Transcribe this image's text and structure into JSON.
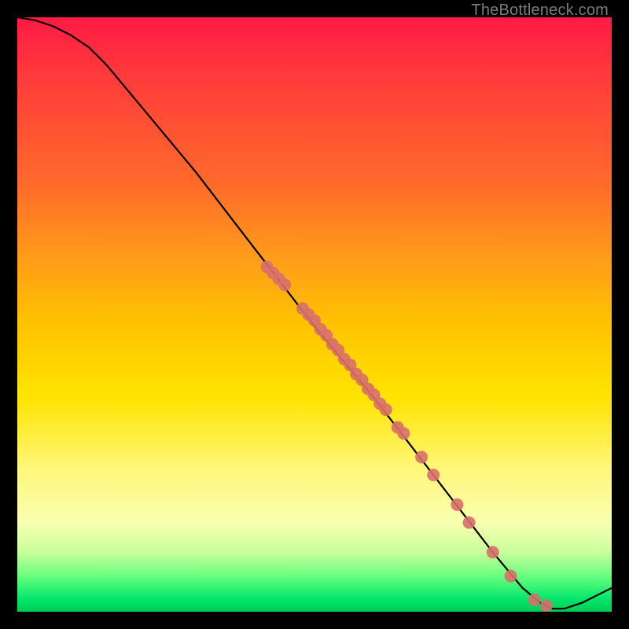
{
  "attribution": "TheBottleneck.com",
  "chart_data": {
    "type": "line",
    "title": "",
    "xlabel": "",
    "ylabel": "",
    "xlim": [
      0,
      100
    ],
    "ylim": [
      0,
      100
    ],
    "gradient_colors": {
      "top": "#ff1a44",
      "mid_high": "#ff9a1a",
      "mid": "#ffe400",
      "low": "#c9ff9a",
      "bottom": "#00cc55"
    },
    "series": [
      {
        "name": "bottleneck-curve",
        "color": "#000000",
        "x": [
          0,
          3,
          6,
          9,
          12,
          15,
          20,
          30,
          40,
          50,
          60,
          70,
          80,
          85,
          88,
          90,
          92,
          95,
          100
        ],
        "y": [
          100,
          99.5,
          98.5,
          97,
          95,
          92,
          86,
          74,
          61,
          48,
          36,
          23,
          10,
          4,
          1.5,
          0.5,
          0.5,
          1.5,
          4
        ]
      }
    ],
    "markers": {
      "name": "sample-points",
      "color": "#d86f6a",
      "radius": 8,
      "points": [
        {
          "x": 42,
          "y": 58
        },
        {
          "x": 43,
          "y": 57
        },
        {
          "x": 44,
          "y": 56
        },
        {
          "x": 45,
          "y": 55
        },
        {
          "x": 48,
          "y": 51
        },
        {
          "x": 49,
          "y": 50
        },
        {
          "x": 50,
          "y": 49
        },
        {
          "x": 51,
          "y": 47.5
        },
        {
          "x": 52,
          "y": 46.5
        },
        {
          "x": 53,
          "y": 45
        },
        {
          "x": 54,
          "y": 44
        },
        {
          "x": 55,
          "y": 42.5
        },
        {
          "x": 56,
          "y": 41.5
        },
        {
          "x": 57,
          "y": 40
        },
        {
          "x": 58,
          "y": 39
        },
        {
          "x": 59,
          "y": 37.5
        },
        {
          "x": 60,
          "y": 36.5
        },
        {
          "x": 61,
          "y": 35
        },
        {
          "x": 62,
          "y": 34
        },
        {
          "x": 64,
          "y": 31
        },
        {
          "x": 65,
          "y": 30
        },
        {
          "x": 68,
          "y": 26
        },
        {
          "x": 70,
          "y": 23
        },
        {
          "x": 74,
          "y": 18
        },
        {
          "x": 76,
          "y": 15
        },
        {
          "x": 80,
          "y": 10
        },
        {
          "x": 83,
          "y": 6
        },
        {
          "x": 87,
          "y": 2
        },
        {
          "x": 89,
          "y": 1
        }
      ]
    }
  }
}
